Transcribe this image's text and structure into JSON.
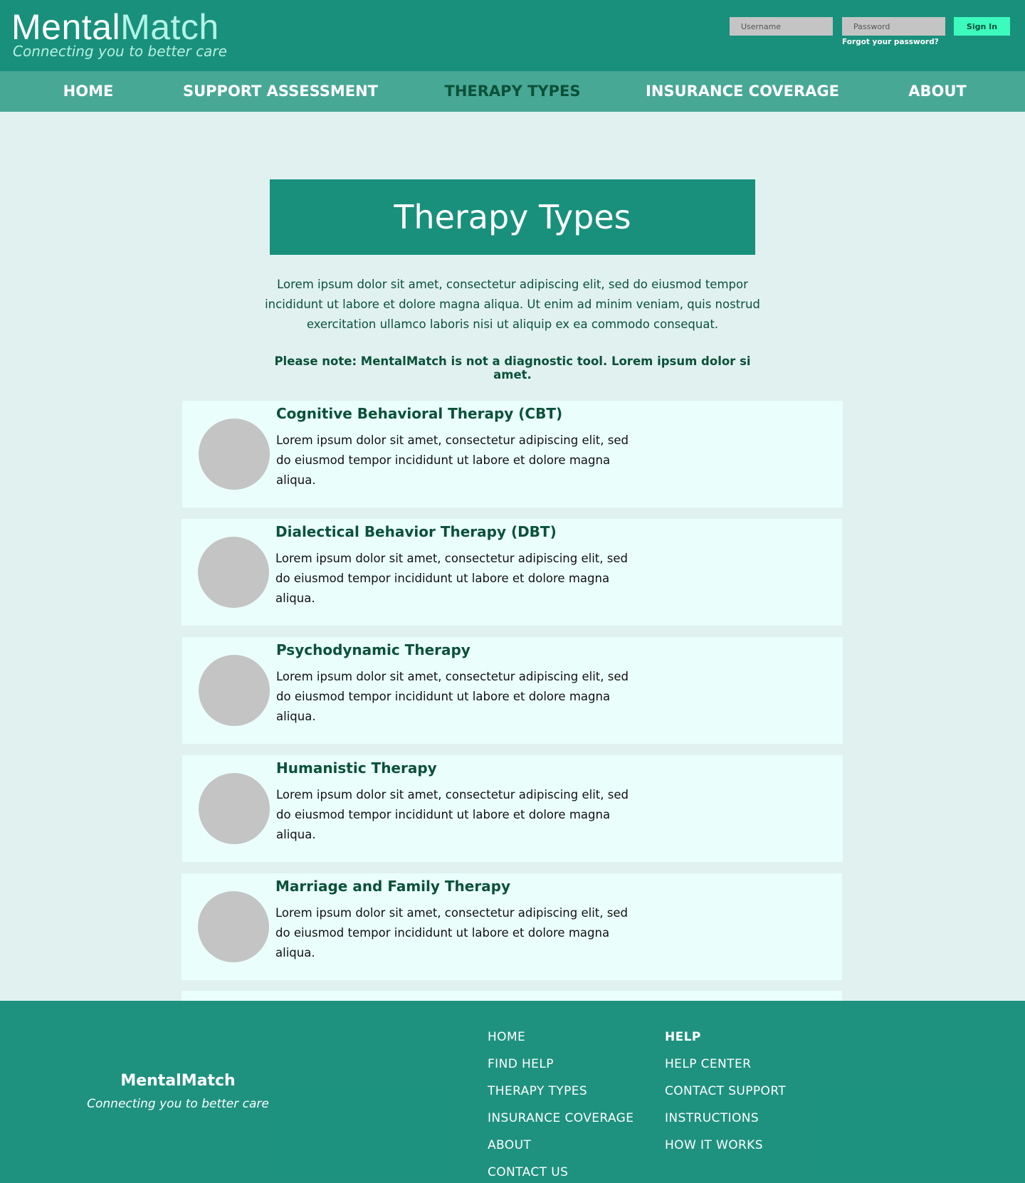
{
  "header": {
    "logo_main": "Mental",
    "logo_accent": "Match",
    "tagline": "Connecting you to better care",
    "username_placeholder": "Username",
    "password_placeholder": "Password",
    "signin_label": "Sign In",
    "forgot_label": "Forgot your password?"
  },
  "nav": {
    "items": [
      {
        "label": "HOME"
      },
      {
        "label": "SUPPORT ASSESSMENT"
      },
      {
        "label": "THERAPY TYPES",
        "active": true
      },
      {
        "label": "INSURANCE COVERAGE"
      },
      {
        "label": "ABOUT"
      }
    ]
  },
  "main": {
    "title": "Therapy Types",
    "intro": "Lorem ipsum dolor sit amet, consectetur adipiscing elit, sed do eiusmod tempor incididunt ut labore et dolore magna aliqua. Ut enim ad minim veniam, quis nostrud exercitation ullamco laboris nisi ut aliquip ex ea commodo consequat.",
    "note": "Please note: MentalMatch is not a diagnostic tool. Lorem ipsum dolor si amet.",
    "cards": [
      {
        "title": "Cognitive Behavioral Therapy (CBT)",
        "desc": "Lorem ipsum dolor sit amet, consectetur adipiscing elit, sed do eiusmod tempor incididunt ut labore et dolore magna aliqua."
      },
      {
        "title": "Dialectical Behavior Therapy (DBT)",
        "desc": "Lorem ipsum dolor sit amet, consectetur adipiscing elit, sed do eiusmod tempor incididunt ut labore et dolore magna aliqua."
      },
      {
        "title": "Psychodynamic Therapy",
        "desc": "Lorem ipsum dolor sit amet, consectetur adipiscing elit, sed do eiusmod tempor incididunt ut labore et dolore magna aliqua."
      },
      {
        "title": "Humanistic Therapy",
        "desc": "Lorem ipsum dolor sit amet, consectetur adipiscing elit, sed do eiusmod tempor incididunt ut labore et dolore magna aliqua."
      },
      {
        "title": "Marriage and Family Therapy",
        "desc": "Lorem ipsum dolor sit amet, consectetur adipiscing elit, sed do eiusmod tempor incididunt ut labore et dolore magna aliqua."
      }
    ]
  },
  "footer": {
    "brand": "MentalMatch",
    "tagline": "Connecting you to better care",
    "col1": [
      "HOME",
      "FIND HELP",
      "THERAPY TYPES",
      "INSURANCE COVERAGE",
      "ABOUT",
      "CONTACT US"
    ],
    "col2_heading": "HELP",
    "col2": [
      "HELP CENTER",
      "CONTACT SUPPORT",
      "INSTRUCTIONS",
      "HOW IT WORKS"
    ]
  },
  "colors": {
    "primary": "#19907c",
    "nav_bg": "#48a896",
    "page_bg": "#e0f1f0",
    "card_bg": "#eafffc",
    "accent_button": "#3dfbbd",
    "dark_text": "#0b5138"
  }
}
